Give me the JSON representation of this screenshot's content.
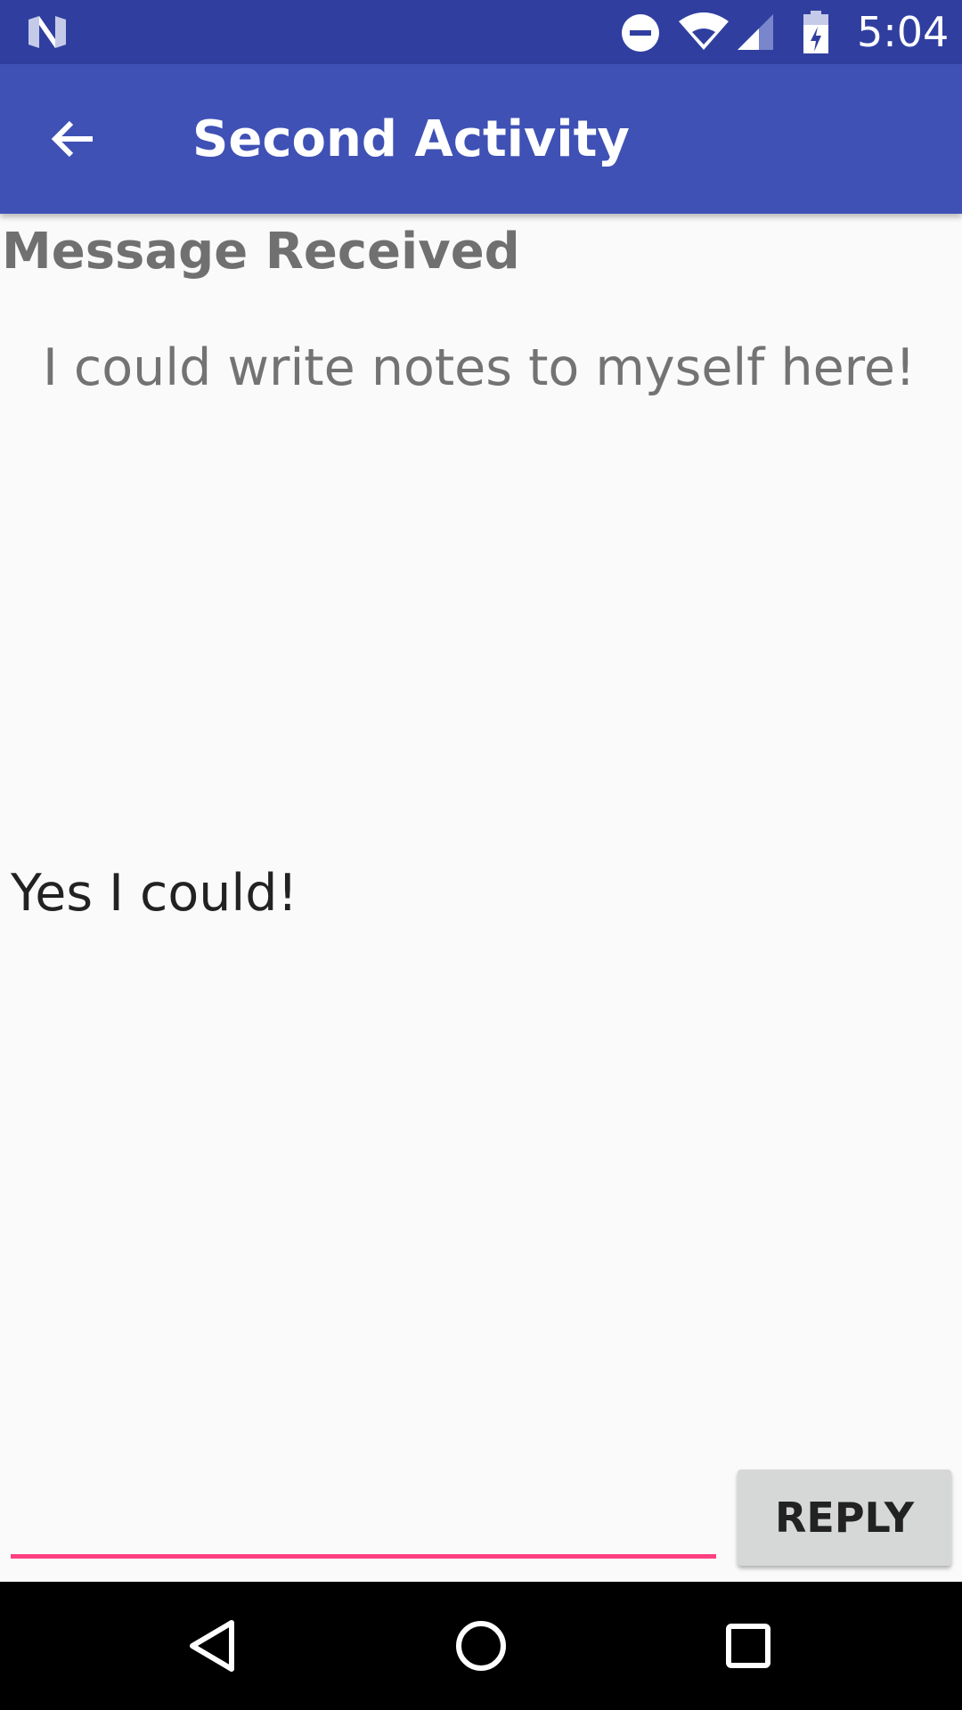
{
  "status_bar": {
    "time": "5:04",
    "icons": [
      "n-logo-icon",
      "do-not-disturb-icon",
      "wifi-icon",
      "cellular-signal-icon",
      "battery-charging-icon"
    ]
  },
  "app_bar": {
    "title": "Second Activity",
    "back_icon": "arrow-back-icon",
    "color": "#3f51b5"
  },
  "content": {
    "heading": "Message Received",
    "message": "I could write notes to myself here!",
    "reply_text": "Yes I could!"
  },
  "reply_bar": {
    "input_value": "",
    "input_placeholder": "",
    "button_label": "REPLY",
    "accent_color": "#ff4081"
  },
  "nav_bar": {
    "icons": [
      "nav-back-icon",
      "nav-home-icon",
      "nav-recents-icon"
    ]
  },
  "colors": {
    "status_bar": "#303f9f",
    "app_bar": "#3f51b5",
    "accent": "#ff4081",
    "background": "#fafafa"
  }
}
